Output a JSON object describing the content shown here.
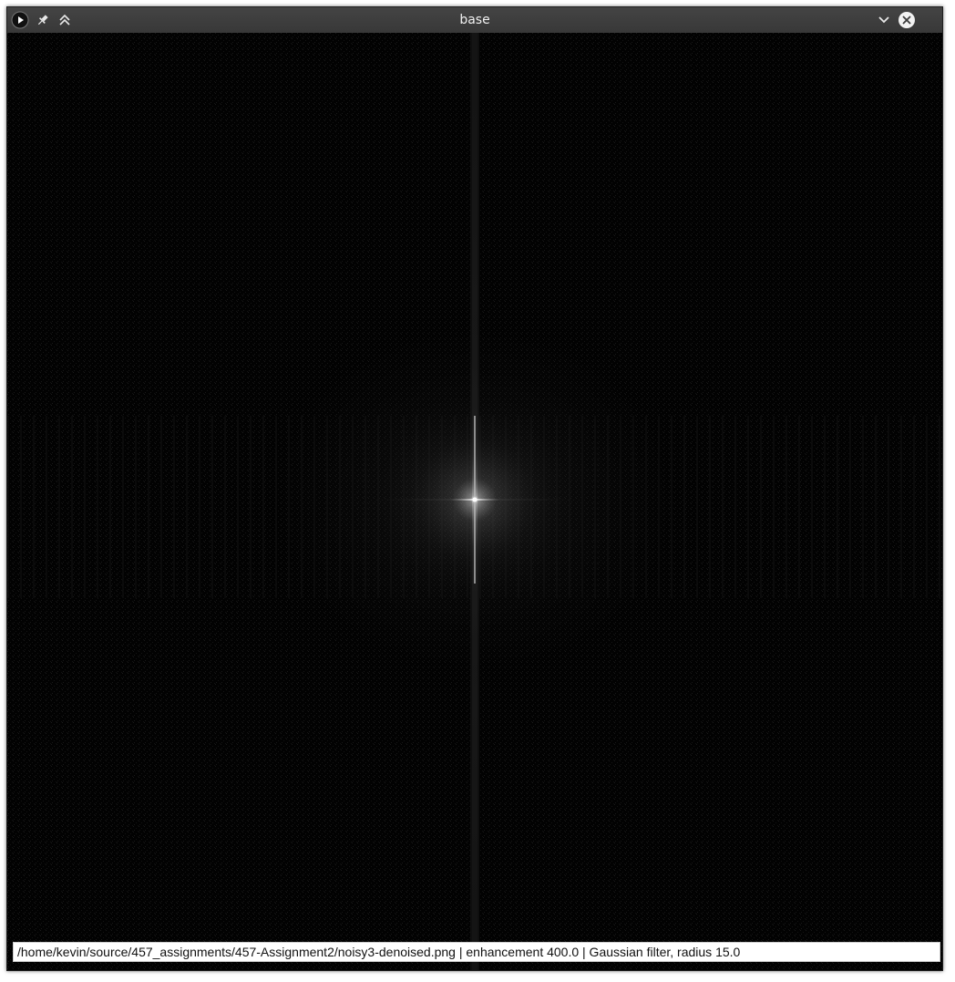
{
  "window": {
    "title": "base"
  },
  "titlebar": {
    "buttons_left": [
      {
        "icon": "app-menu-icon"
      },
      {
        "icon": "pin-icon"
      },
      {
        "icon": "shade-up-icon"
      }
    ],
    "buttons_right": [
      {
        "icon": "minimize-chevron-icon"
      },
      {
        "icon": "close-icon"
      }
    ]
  },
  "image_view": {
    "content": "fourier-magnitude-spectrum"
  },
  "status": {
    "text": "/home/kevin/source/457_assignments/457-Assignment2/noisy3-denoised.png  |  enhancement 400.0  |  Gaussian filter, radius 15.0"
  },
  "colors": {
    "titlebar": "#3d3d3d",
    "title_text": "#f0f0f0",
    "canvas": "#020202",
    "status_bg": "#ffffff"
  }
}
